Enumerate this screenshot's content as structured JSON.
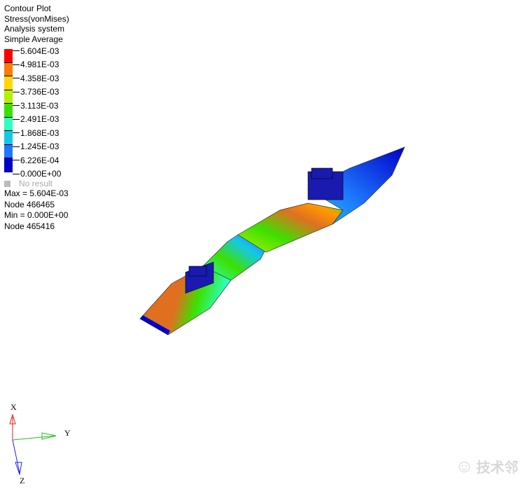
{
  "legend": {
    "title": "Contour Plot",
    "result": "Stress(vonMises)",
    "system": "Analysis system",
    "averaging": "Simple Average",
    "levels": [
      "5.604E-03",
      "4.981E-03",
      "4.358E-03",
      "3.736E-03",
      "3.113E-03",
      "2.491E-03",
      "1.868E-03",
      "1.245E-03",
      "6.226E-04",
      "0.000E+00"
    ],
    "colors": [
      "#ff0000",
      "#ff7a00",
      "#ffd800",
      "#b4f000",
      "#3ce000",
      "#2effc0",
      "#14c8e8",
      "#1e78ff",
      "#0000c8"
    ],
    "no_result": "No result",
    "max": "Max = 5.604E-03",
    "max_node": "Node 466465",
    "min": "Min = 0.000E+00",
    "min_node": "Node 465416"
  },
  "axes": {
    "x": "X",
    "y": "Y",
    "z": "Z"
  },
  "watermark": "技术邻"
}
